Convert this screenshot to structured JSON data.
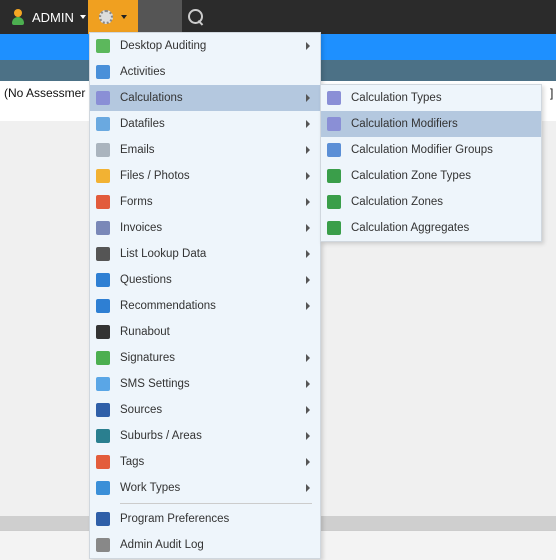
{
  "topbar": {
    "user_label": "ADMIN"
  },
  "page": {
    "assessment_text": "(No Assessmer",
    "right_bracket": "]"
  },
  "menu": {
    "items": [
      {
        "label": "Desktop Auditing",
        "icon": "check-circle-icon",
        "color": "#5cb85c",
        "arrow": true
      },
      {
        "label": "Activities",
        "icon": "grid-icon",
        "color": "#4a90d9",
        "arrow": false
      },
      {
        "label": "Calculations",
        "icon": "calculator-icon",
        "color": "#8a8fd6",
        "arrow": true,
        "active": true
      },
      {
        "label": "Datafiles",
        "icon": "table-icon",
        "color": "#6aa9e0",
        "arrow": true
      },
      {
        "label": "Emails",
        "icon": "envelope-icon",
        "color": "#aab4be",
        "arrow": true
      },
      {
        "label": "Files / Photos",
        "icon": "folder-icon",
        "color": "#f2b233",
        "arrow": true
      },
      {
        "label": "Forms",
        "icon": "pdf-icon",
        "color": "#e25b3c",
        "arrow": true
      },
      {
        "label": "Invoices",
        "icon": "invoice-icon",
        "color": "#7a88b8",
        "arrow": true
      },
      {
        "label": "List Lookup Data",
        "icon": "gear-icon",
        "color": "#555555",
        "arrow": true
      },
      {
        "label": "Questions",
        "icon": "question-icon",
        "color": "#2e7fd3",
        "arrow": true
      },
      {
        "label": "Recommendations",
        "icon": "star-icon",
        "color": "#2e7fd3",
        "arrow": true
      },
      {
        "label": "Runabout",
        "icon": "phone-icon",
        "color": "#333333",
        "arrow": false
      },
      {
        "label": "Signatures",
        "icon": "pen-icon",
        "color": "#4caf50",
        "arrow": true
      },
      {
        "label": "SMS Settings",
        "icon": "chat-icon",
        "color": "#5aa6e6",
        "arrow": true
      },
      {
        "label": "Sources",
        "icon": "link-icon",
        "color": "#2f5fa8",
        "arrow": true
      },
      {
        "label": "Suburbs / Areas",
        "icon": "pin-icon",
        "color": "#2a7f8f",
        "arrow": true
      },
      {
        "label": "Tags",
        "icon": "tag-icon",
        "color": "#e35d3c",
        "arrow": true
      },
      {
        "label": "Work Types",
        "icon": "hierarchy-icon",
        "color": "#3a8fd8",
        "arrow": true
      },
      {
        "label": "Program Preferences",
        "icon": "settings-icon",
        "color": "#2f5fa8",
        "arrow": false
      },
      {
        "label": "Admin Audit Log",
        "icon": "log-icon",
        "color": "#888888",
        "arrow": false
      }
    ]
  },
  "submenu": {
    "items": [
      {
        "label": "Calculation Types",
        "icon": "calculator-icon",
        "color": "#8a8fd6"
      },
      {
        "label": "Calculation Modifiers",
        "icon": "calculator-icon",
        "color": "#8a8fd6",
        "active": true
      },
      {
        "label": "Calculation Modifier Groups",
        "icon": "calculator-group-icon",
        "color": "#5b8fd6"
      },
      {
        "label": "Calculation Zone Types",
        "icon": "globe-icon",
        "color": "#3a9e4a"
      },
      {
        "label": "Calculation Zones",
        "icon": "globe-icon",
        "color": "#3a9e4a"
      },
      {
        "label": "Calculation Aggregates",
        "icon": "globe-icon",
        "color": "#3a9e4a"
      }
    ]
  }
}
